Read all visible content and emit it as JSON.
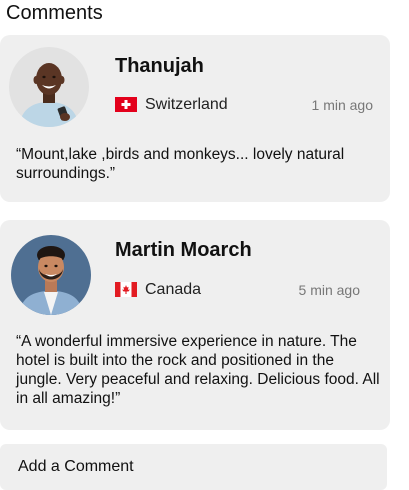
{
  "section": {
    "title": "Comments"
  },
  "comments": [
    {
      "name": "Thanujah",
      "country": "Switzerland",
      "flag": "switzerland-flag",
      "time": "1 min ago",
      "text": "“Mount,lake ,birds and monkeys... lovely natural surroundings.”"
    },
    {
      "name": "Martin Moarch",
      "country": "Canada",
      "flag": "canada-flag",
      "time": "5 min ago",
      "text": "“A wonderful immersive experience in nature. The hotel is built into the rock and positioned in the jungle. Very peaceful and relaxing. Delicious food. All in all amazing!”"
    }
  ],
  "add_comment": {
    "placeholder": "Add a Comment"
  },
  "colors": {
    "card_background": "#efefef",
    "swiss_red": "#e3001b",
    "canada_red": "#e21b22",
    "muted_text": "#777777"
  }
}
